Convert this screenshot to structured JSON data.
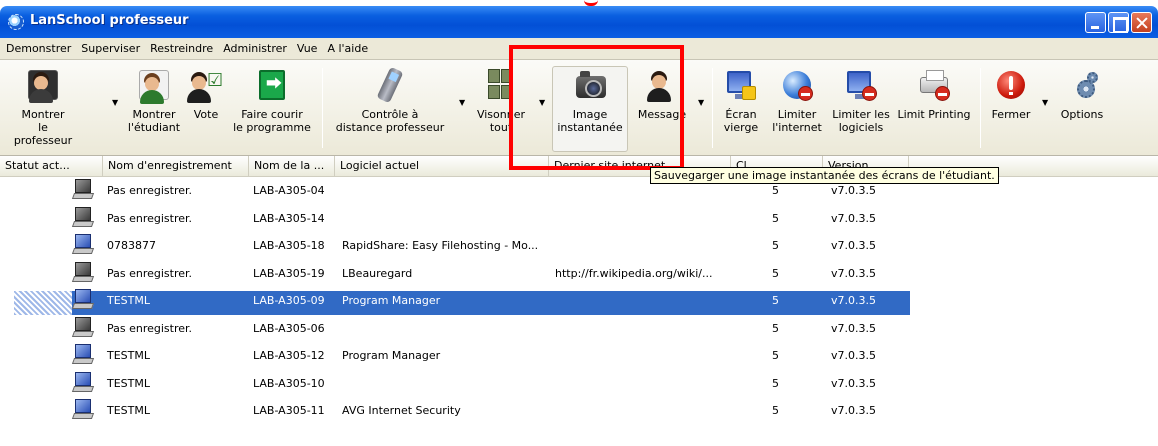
{
  "window": {
    "title": "LanSchool professeur"
  },
  "menu": [
    "Demonstrer",
    "Superviser",
    "Restreindre",
    "Administrer",
    "Vue",
    "A l'aide"
  ],
  "toolbar": {
    "show_teacher": "Montrer\nle professeur",
    "show_student": "Montrer\nl'étudiant",
    "vote": "Vote",
    "run_program": "Faire courir\nle programme",
    "remote_control": "Contrôle à\ndistance professeur",
    "view_all": "Visonner\ntout",
    "snapshot": "Image\ninstantanée",
    "message": "Message",
    "blank_screen": "Écran\nvierge",
    "limit_internet": "Limiter\nl'internet",
    "limit_software": "Limiter les\nlogiciels",
    "limit_printing": "Limit Printing",
    "close": "Fermer",
    "options": "Options"
  },
  "tooltip": "Sauvegarger une image instantanée des écrans de l'étudiant.",
  "columns": [
    "Statut act...",
    "Nom d'enregistrement",
    "Nom de la ...",
    "Logiciel actuel",
    "Dernier site internet",
    "Cl...",
    "Version"
  ],
  "rows": [
    {
      "icon": "gray",
      "login": "Pas enregistrer.",
      "machine": "LAB-A305-04",
      "software": "",
      "site": "",
      "c": "5",
      "version": "v7.0.3.5"
    },
    {
      "icon": "gray",
      "login": "Pas enregistrer.",
      "machine": "LAB-A305-14",
      "software": "",
      "site": "",
      "c": "5",
      "version": "v7.0.3.5"
    },
    {
      "icon": "blue",
      "login": "0783877",
      "machine": "LAB-A305-18",
      "software": "RapidShare: Easy Filehosting - Mo...",
      "site": "",
      "c": "5",
      "version": "v7.0.3.5"
    },
    {
      "icon": "gray",
      "login": "Pas enregistrer.",
      "machine": "LAB-A305-19",
      "software": "LBeauregard",
      "site": "http://fr.wikipedia.org/wiki/...",
      "c": "5",
      "version": "v7.0.3.5"
    },
    {
      "icon": "blue",
      "login": "TESTML",
      "machine": "LAB-A305-09",
      "software": "Program Manager",
      "site": "",
      "c": "5",
      "version": "v7.0.3.5",
      "selected": true
    },
    {
      "icon": "gray",
      "login": "Pas enregistrer.",
      "machine": "LAB-A305-06",
      "software": "",
      "site": "",
      "c": "5",
      "version": "v7.0.3.5"
    },
    {
      "icon": "blue",
      "login": "TESTML",
      "machine": "LAB-A305-12",
      "software": "Program Manager",
      "site": "",
      "c": "5",
      "version": "v7.0.3.5"
    },
    {
      "icon": "blue",
      "login": "TESTML",
      "machine": "LAB-A305-10",
      "software": "",
      "site": "",
      "c": "5",
      "version": "v7.0.3.5"
    },
    {
      "icon": "blue",
      "login": "TESTML",
      "machine": "LAB-A305-11",
      "software": "AVG Internet Security",
      "site": "",
      "c": "5",
      "version": "v7.0.3.5"
    }
  ]
}
